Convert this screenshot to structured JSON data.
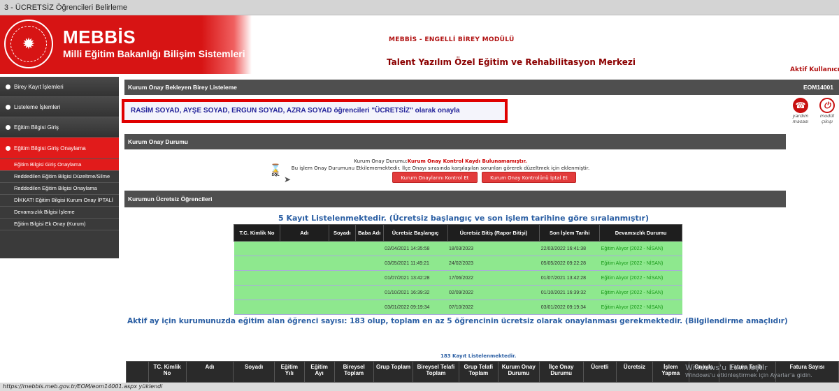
{
  "window": {
    "title": "3 - ÜCRETSİZ Öğrencileri Belirleme"
  },
  "header": {
    "brand": "MEBBİS",
    "brand_sub": "Milli Eğitim Bakanlığı Bilişim Sistemleri",
    "module": "MEBBİS - ENGELLİ BİREY MODÜLÜ",
    "institution": "Talent Yazılım Özel Eğitim ve Rehabilitasyon Merkezi",
    "active_user_label": "Aktif Kullanıcı:"
  },
  "sidebar": {
    "items": [
      {
        "label": "Birey Kayıt İşlemleri"
      },
      {
        "label": "Listeleme İşlemleri"
      },
      {
        "label": "Eğitim Bilgisi Giriş"
      },
      {
        "label": "Eğitim Bilgisi Giriş Onaylama"
      }
    ],
    "subitems": [
      {
        "label": "Eğitim Bilgisi Giriş Onaylama"
      },
      {
        "label": "Reddedilen Eğitim Bilgisi Düzeltme/Silme"
      },
      {
        "label": "Reddedilen Eğitim Bilgisi Onaylama"
      },
      {
        "label": "DİKKAT! Eğitim Bilgisi Kurum Onay İPTALİ"
      },
      {
        "label": "Devamsızlık Bilgisi İşleme"
      },
      {
        "label": "Eğitim Bilgisi Ek Onay (Kurum)"
      }
    ]
  },
  "panels": {
    "list_title": "Kurum Onay Bekleyen Birey Listeleme",
    "eom_code": "EOM14001",
    "status_title": "Kurum Onay Durumu",
    "free_title": "Kurumun Ücretsiz Öğrencileri"
  },
  "notice": {
    "text": "RASİM SOYAD, AYŞE SOYAD, ERGUN SOYAD, AZRA SOYAD öğrencileri \"ÜCRETSİZ\" olarak onayla"
  },
  "icons": {
    "help_label": "yardım masası",
    "exit_label": "modül çıkışı"
  },
  "status": {
    "line1_prefix": "Kurum Onay Durumu:",
    "line1_value": "Kurum Onay Kontrol Kaydı Bulunamamıştır.",
    "line2": "Bu işlem Onay Durumunu Etkilememektedir. İlçe Onayı sırasında karşılaşılan sorunları görerek düzeltmek için eklenmiştir.",
    "btn_check": "Kurum Onaylarını Kontrol Et",
    "btn_cancel": "Kurum Onay Kontrolünü İptal Et",
    "sql_label": "SQL"
  },
  "students": {
    "records_title": "5 Kayıt Listelenmektedir. (Ücretsiz başlangıç ve son işlem tarihine göre sıralanmıştır)",
    "headers": [
      "T.C. Kimlik No",
      "Adı",
      "Soyadı",
      "Baba Adı",
      "Ücretsiz Başlangıç",
      "Ücretsiz Bitiş (Rapor Bitişi)",
      "Son İşlem Tarihi",
      "Devamsızlık Durumu"
    ],
    "rows": [
      {
        "start": "02/04/2021 14:35:58",
        "end": "18/03/2023",
        "last": "22/03/2022 16:41:38",
        "status": "Eğitim Alıyor (2022 - NİSAN)"
      },
      {
        "start": "03/05/2021 11:49:21",
        "end": "24/02/2023",
        "last": "05/05/2022 09:22:28",
        "status": "Eğitim Alıyor (2022 - NİSAN)"
      },
      {
        "start": "01/07/2021 13:42:28",
        "end": "17/06/2022",
        "last": "01/07/2021 13:42:28",
        "status": "Eğitim Alıyor (2022 - NİSAN)"
      },
      {
        "start": "01/10/2021 16:39:32",
        "end": "02/09/2022",
        "last": "01/10/2021 16:39:32",
        "status": "Eğitim Alıyor (2022 - NİSAN)"
      },
      {
        "start": "03/01/2022 09:19:34",
        "end": "07/10/2022",
        "last": "03/01/2022 09:19:34",
        "status": "Eğitim Alıyor (2022 - NİSAN)"
      }
    ]
  },
  "summary": "Aktif ay için kurumunuzda eğitim alan öğrenci sayısı: 183 olup, toplam en az 5 öğrencinin ücretsiz olarak onaylanması gerekmektedir. (Bilgilendirme amaçlıdır)",
  "bottom": {
    "records": "183 Kayıt Listelenmektedir.",
    "headers": [
      "TC. Kimlik No",
      "Adı",
      "Soyadı",
      "Eğitim Yılı",
      "Eğitim Ayı",
      "Bireysel Toplam",
      "Grup Toplam",
      "Bireysel Telafi Toplam",
      "Grup Telafi Toplam",
      "Kurum Onay Durumu",
      "İlçe Onay Durumu",
      "Ücretli",
      "Ücretsiz",
      "İşlem Yapma",
      "Onayla",
      "Fatura Tarihi",
      "Fatura Sayısı"
    ]
  },
  "statusbar": {
    "text": "https://mebbis.meb.gov.tr/EOM/eom14001.aspx yüklendi"
  },
  "watermark": {
    "title": "Windows'u Etkinleştir",
    "sub": "Windows'u etkinleştirmek için Ayarlar'a gidin."
  }
}
